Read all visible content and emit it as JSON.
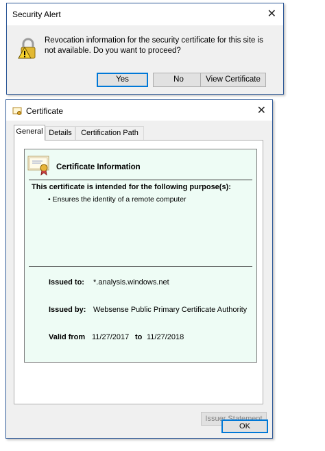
{
  "security_alert": {
    "title": "Security Alert",
    "message": "Revocation information for the security certificate for this site is not available. Do you want to proceed?",
    "buttons": {
      "yes": "Yes",
      "no": "No",
      "view_certificate": "View Certificate"
    },
    "icon": "warning-lock-icon"
  },
  "certificate": {
    "title": "Certificate",
    "tabs": [
      "General",
      "Details",
      "Certification Path"
    ],
    "active_tab": "General",
    "info_heading": "Certificate Information",
    "purpose_heading": "This certificate is intended for the following purpose(s):",
    "purposes": [
      "• Ensures the identity of a remote computer"
    ],
    "issued_to_label": "Issued to:",
    "issued_to": "*.analysis.windows.net",
    "issued_by_label": "Issued by:",
    "issued_by": "Websense Public Primary Certificate Authority",
    "valid_from_label": "Valid from",
    "valid_from": "11/27/2017",
    "valid_to_label": "to",
    "valid_to": "11/27/2018",
    "issuer_statement_button": "Issuer Statement",
    "ok_button": "OK"
  },
  "colors": {
    "accent": "#0078d7",
    "info_background": "#eefcf5",
    "window_border": "#2b5797"
  }
}
